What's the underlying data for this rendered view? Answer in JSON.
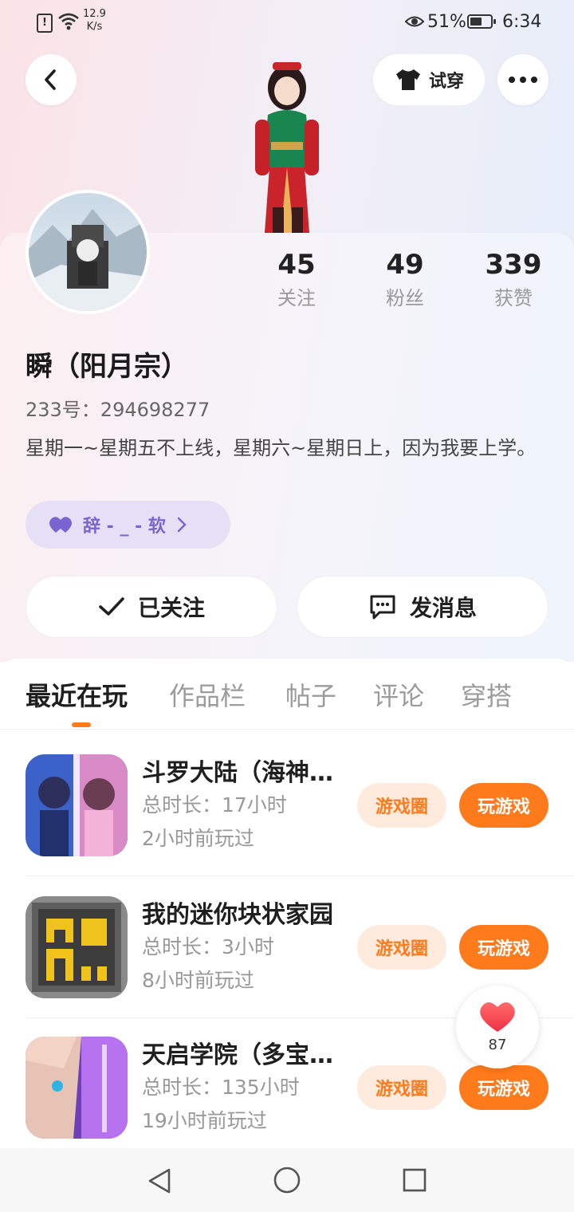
{
  "status_bar": {
    "net_speed_value": "12.9",
    "net_speed_unit": "K/s",
    "battery": "51%",
    "time": "6:34"
  },
  "header": {
    "try_on_label": "试穿"
  },
  "profile": {
    "name": "瞬（阳月宗）",
    "uid_line": "233号：294698277",
    "bio": "星期一~星期五不上线，星期六~星期日上，因为我要上学。",
    "relation_tag": "辞 - _ - 软",
    "stats": [
      {
        "value": "45",
        "label": "关注"
      },
      {
        "value": "49",
        "label": "粉丝"
      },
      {
        "value": "339",
        "label": "获赞"
      }
    ]
  },
  "actions": {
    "follow_label": "已关注",
    "message_label": "发消息"
  },
  "tabs": [
    {
      "label": "最近在玩",
      "active": true
    },
    {
      "label": "作品栏"
    },
    {
      "label": "帖子"
    },
    {
      "label": "评论"
    },
    {
      "label": "穿搭"
    }
  ],
  "games": [
    {
      "title": "斗罗大陆（海神…",
      "duration": "总时长：17小时",
      "last_played": "2小时前玩过",
      "circle_label": "游戏圈",
      "play_label": "玩游戏"
    },
    {
      "title": "我的迷你块状家园",
      "duration": "总时长：3小时",
      "last_played": "8小时前玩过",
      "circle_label": "游戏圈",
      "play_label": "玩游戏"
    },
    {
      "title": "天启学院（多宝…",
      "duration": "总时长：135小时",
      "last_played": "19小时前玩过",
      "circle_label": "游戏圈",
      "play_label": "玩游戏"
    }
  ],
  "floating_like": {
    "count": "87"
  },
  "colors": {
    "accent": "#ff7a1a",
    "tag_text": "#7a64d2",
    "tag_bg": "#e5e0f5"
  },
  "icons": [
    "back-arrow-icon",
    "shirt-icon",
    "more-icon",
    "heart-icon",
    "check-icon",
    "chat-icon",
    "nav-back-icon",
    "nav-home-icon",
    "nav-recent-icon"
  ]
}
